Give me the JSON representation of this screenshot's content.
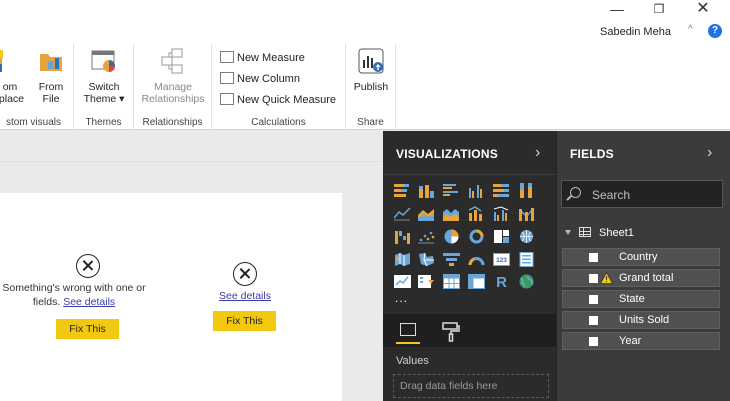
{
  "window": {
    "minimize_glyph": "—",
    "restore_glyph": "❐",
    "close_glyph": "✕",
    "user_name": "Sabedin Meha",
    "collapse_glyph": "^",
    "help_glyph": "?"
  },
  "ribbon": {
    "groups": {
      "custom_visuals": {
        "label": "stom visuals",
        "btn_marketplace_l1": "om",
        "btn_marketplace_l2": "tplace",
        "btn_file_l1": "From",
        "btn_file_l2": "File"
      },
      "themes": {
        "label": "Themes",
        "btn_l1": "Switch",
        "btn_l2": "Theme ▾"
      },
      "relationships": {
        "label": "Relationships",
        "btn_l1": "Manage",
        "btn_l2": "Relationships"
      },
      "calculations": {
        "label": "Calculations",
        "new_measure": "New Measure",
        "new_column": "New Column",
        "new_quick_measure": "New Quick Measure"
      },
      "share": {
        "label": "Share",
        "btn": "Publish"
      }
    }
  },
  "canvas": {
    "visual1": {
      "line1": "Something's wrong with one or",
      "line2_prefix": "fields. ",
      "link": "See details",
      "fix": "Fix This"
    },
    "visual2": {
      "link": "See details",
      "fix": "Fix This"
    }
  },
  "visualizations": {
    "title": "VISUALIZATIONS",
    "arrow": "›",
    "more": "...",
    "values_label": "Values",
    "drop_placeholder": "Drag data fields here",
    "r_letter": "R",
    "card_digits": "123"
  },
  "fields": {
    "title": "FIELDS",
    "arrow": "›",
    "search_placeholder": "Search",
    "table_name": "Sheet1",
    "items": [
      {
        "name": "Country"
      },
      {
        "name": "Grand total"
      },
      {
        "name": "State"
      },
      {
        "name": "Units Sold"
      },
      {
        "name": "Year"
      }
    ]
  },
  "colors": {
    "accent_yellow": "#f2c811",
    "pane_dark": "#2b2b2b",
    "fields_bg": "#3b3b3b",
    "link_blue": "#3a3aa8",
    "viz_orange": "#e8a33d",
    "viz_blue": "#6aa7d8"
  }
}
